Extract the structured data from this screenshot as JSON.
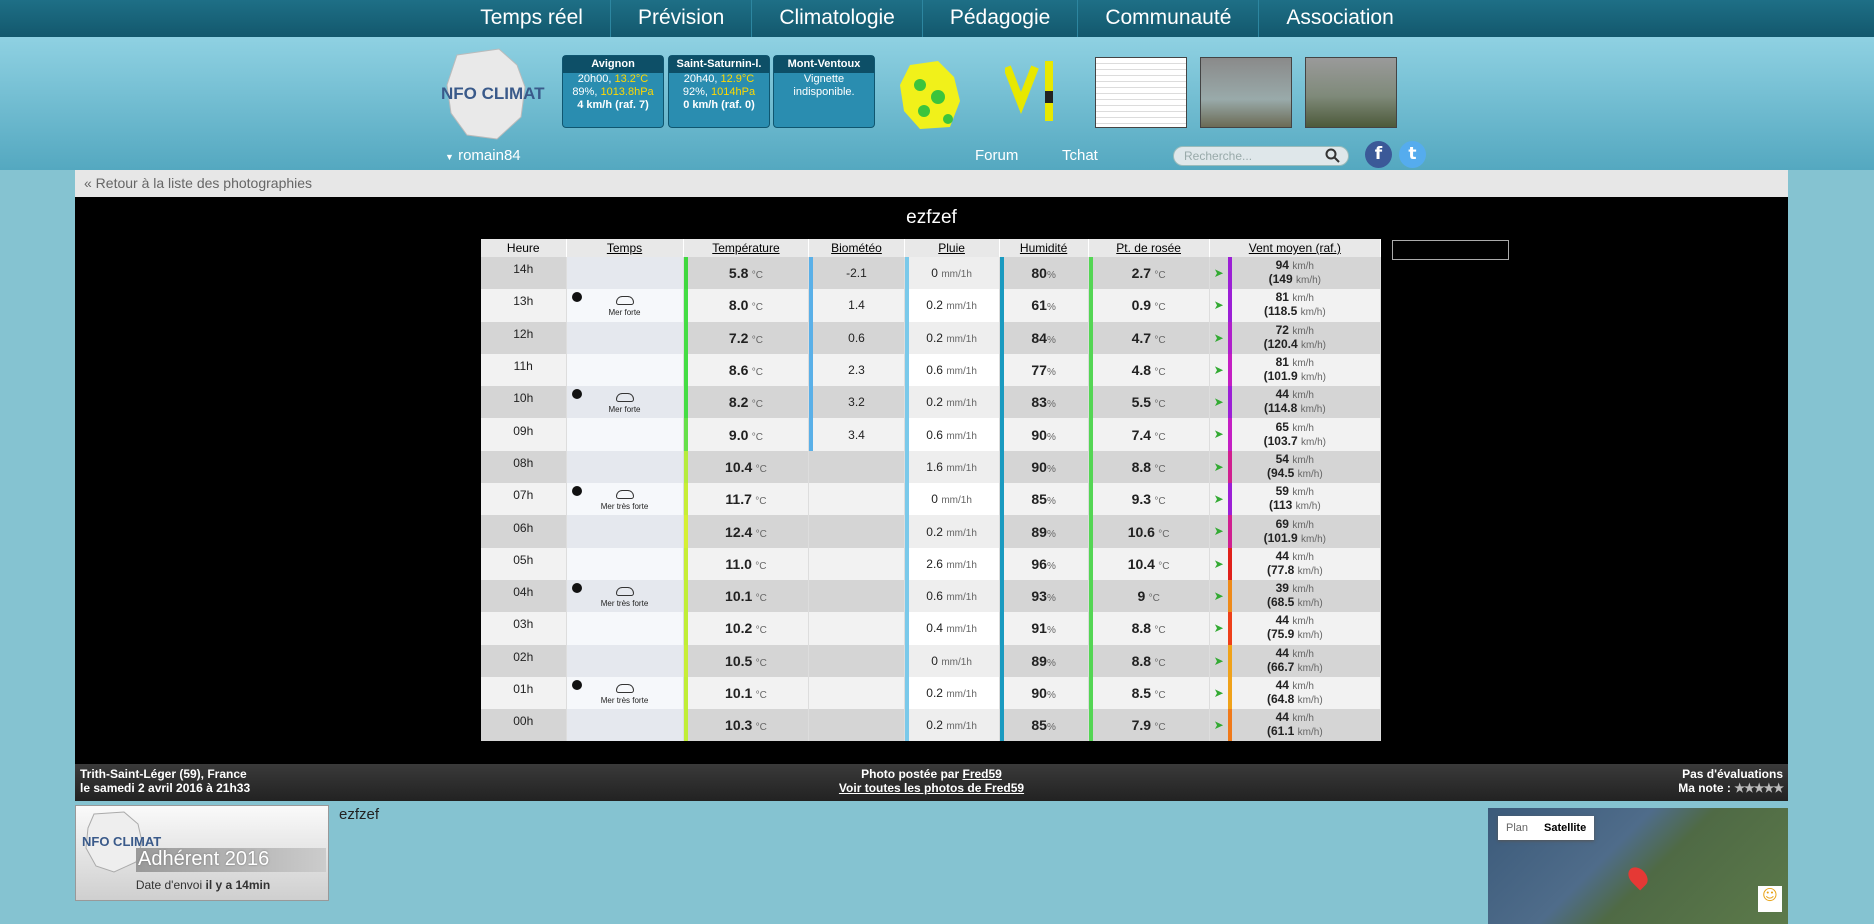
{
  "nav": [
    "Temps réel",
    "Prévision",
    "Climatologie",
    "Pédagogie",
    "Communauté",
    "Association"
  ],
  "stations": [
    {
      "name": "Avignon",
      "l1a": "20h00, ",
      "l1b": "13.2°C",
      "l2a": "89%, ",
      "l2b": "1013.8hPa",
      "l3": "4 km/h (raf. 7)"
    },
    {
      "name": "Saint-Saturnin-l.",
      "l1a": "20h40, ",
      "l1b": "12.9°C",
      "l2a": "92%, ",
      "l2b": "1014hPa",
      "l3": "0 km/h (raf. 0)"
    },
    {
      "name": "Mont-Ventoux",
      "l1a": "Vignette",
      "l1b": "",
      "l2a": "indisponible.",
      "l2b": "",
      "l3": ""
    }
  ],
  "header": {
    "user": "romain84",
    "forum": "Forum",
    "tchat": "Tchat",
    "search_placeholder": "Recherche...",
    "logo_text": "NFO CLIMAT"
  },
  "page": {
    "back": "« Retour à la liste des photographies",
    "title": "ezfzef"
  },
  "table": {
    "headers": [
      "Heure",
      "Temps",
      "Température",
      "Biométéo",
      "Pluie",
      "Humidité",
      "Pt. de rosée",
      "Vent moyen (raf.)"
    ],
    "rows": [
      {
        "h": "14h",
        "wt": "",
        "t": "5.8",
        "bio": "-2.1",
        "rain": "0",
        "hum": "80",
        "dew": "2.7",
        "wind": "94",
        "gust": "(149 "
      },
      {
        "h": "13h",
        "wt": "Mer forte",
        "t": "8.0",
        "bio": "1.4",
        "rain": "0.2",
        "hum": "61",
        "dew": "0.9",
        "wind": "81",
        "gust": "(118.5 "
      },
      {
        "h": "12h",
        "wt": "",
        "t": "7.2",
        "bio": "0.6",
        "rain": "0.2",
        "hum": "84",
        "dew": "4.7",
        "wind": "72",
        "gust": "(120.4 "
      },
      {
        "h": "11h",
        "wt": "",
        "t": "8.6",
        "bio": "2.3",
        "rain": "0.6",
        "hum": "77",
        "dew": "4.8",
        "wind": "81",
        "gust": "(101.9 "
      },
      {
        "h": "10h",
        "wt": "Mer forte",
        "t": "8.2",
        "bio": "3.2",
        "rain": "0.2",
        "hum": "83",
        "dew": "5.5",
        "wind": "44",
        "gust": "(114.8 "
      },
      {
        "h": "09h",
        "wt": "",
        "t": "9.0",
        "bio": "3.4",
        "rain": "0.6",
        "hum": "90",
        "dew": "7.4",
        "wind": "65",
        "gust": "(103.7 "
      },
      {
        "h": "08h",
        "wt": "",
        "t": "10.4",
        "bio": "",
        "rain": "1.6",
        "hum": "90",
        "dew": "8.8",
        "wind": "54",
        "gust": "(94.5 "
      },
      {
        "h": "07h",
        "wt": "Mer très forte",
        "t": "11.7",
        "bio": "",
        "rain": "0",
        "hum": "85",
        "dew": "9.3",
        "wind": "59",
        "gust": "(113 "
      },
      {
        "h": "06h",
        "wt": "",
        "t": "12.4",
        "bio": "",
        "rain": "0.2",
        "hum": "89",
        "dew": "10.6",
        "wind": "69",
        "gust": "(101.9 "
      },
      {
        "h": "05h",
        "wt": "",
        "t": "11.0",
        "bio": "",
        "rain": "2.6",
        "hum": "96",
        "dew": "10.4",
        "wind": "44",
        "gust": "(77.8 "
      },
      {
        "h": "04h",
        "wt": "Mer très forte",
        "t": "10.1",
        "bio": "",
        "rain": "0.6",
        "hum": "93",
        "dew": "9",
        "wind": "39",
        "gust": "(68.5 "
      },
      {
        "h": "03h",
        "wt": "",
        "t": "10.2",
        "bio": "",
        "rain": "0.4",
        "hum": "91",
        "dew": "8.8",
        "wind": "44",
        "gust": "(75.9 "
      },
      {
        "h": "02h",
        "wt": "",
        "t": "10.5",
        "bio": "",
        "rain": "0",
        "hum": "89",
        "dew": "8.8",
        "wind": "44",
        "gust": "(66.7 "
      },
      {
        "h": "01h",
        "wt": "Mer très forte",
        "t": "10.1",
        "bio": "",
        "rain": "0.2",
        "hum": "90",
        "dew": "8.5",
        "wind": "44",
        "gust": "(64.8 "
      },
      {
        "h": "00h",
        "wt": "",
        "t": "10.3",
        "bio": "",
        "rain": "0.2",
        "hum": "85",
        "dew": "7.9",
        "wind": "44",
        "gust": "(61.1 "
      }
    ],
    "units": {
      "t": "°C",
      "rain": "mm/1h",
      "hum": "%",
      "wind": "km/h",
      "gust_close": "km/h)"
    }
  },
  "info": {
    "location": "Trith-Saint-Léger (59), France",
    "date": "le samedi 2 avril 2016 à 21h33",
    "posted_by": "Photo postée par ",
    "author": "Fred59",
    "all_photos": "Voir toutes les photos de Fred59",
    "evals": "Pas d'évaluations",
    "my_note": "Ma note : ",
    "stars": "★★★★★"
  },
  "bottom": {
    "badge_text": "Adhérent 2016",
    "badge_date_label": "Date d'envoi ",
    "badge_date": "il y a 14min",
    "description": "ezfzef",
    "map_plan": "Plan",
    "map_sat": "Satellite"
  }
}
